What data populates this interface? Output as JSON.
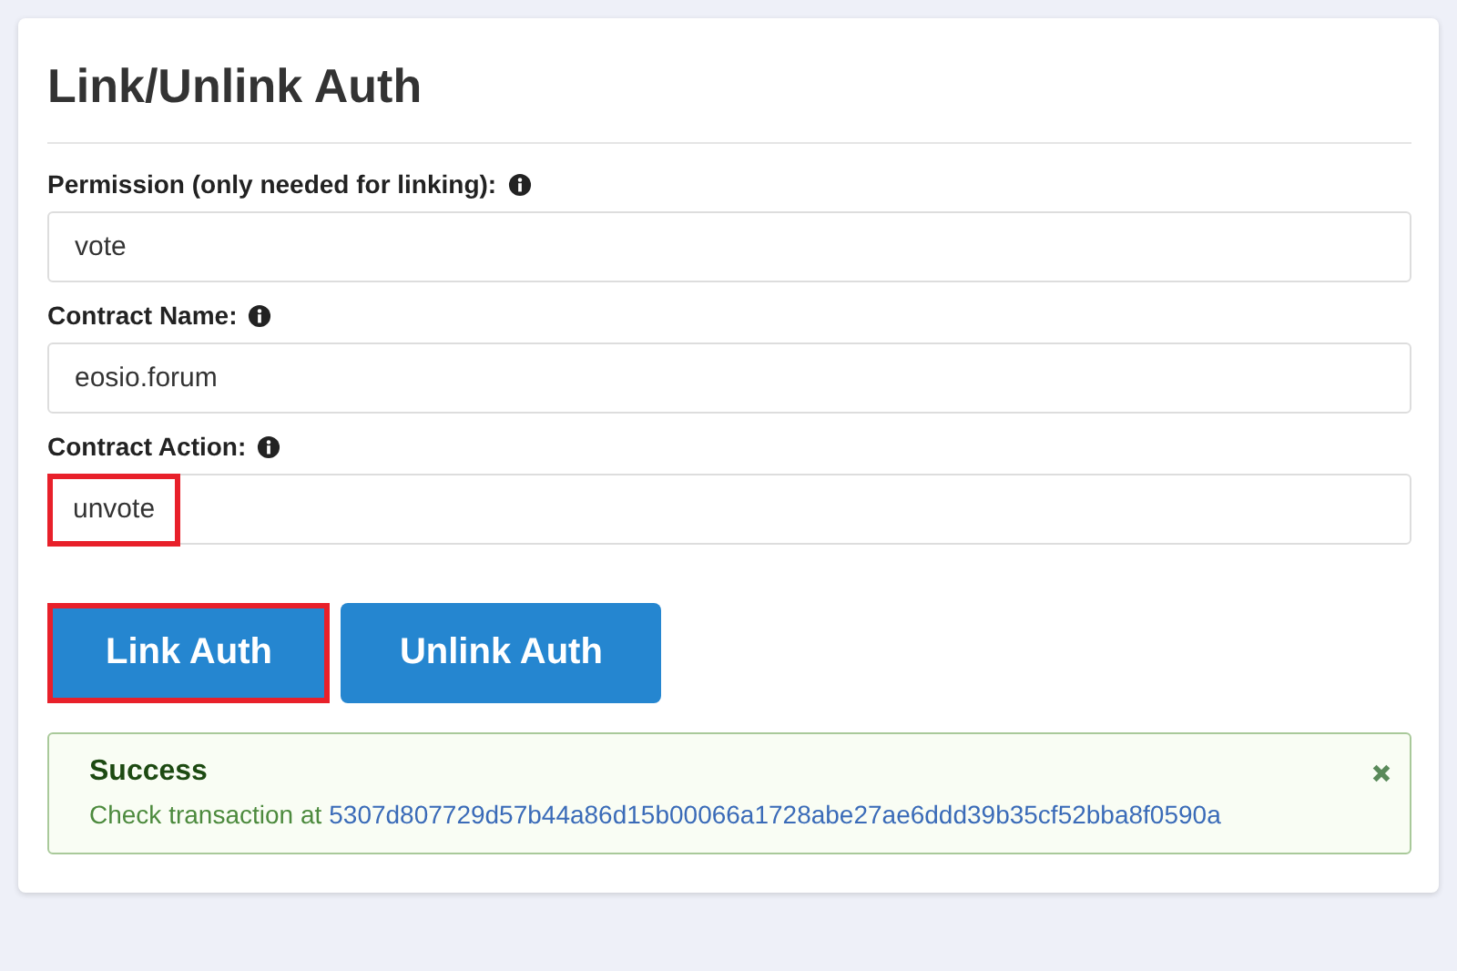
{
  "title": "Link/Unlink Auth",
  "fields": [
    {
      "label": "Permission (only needed for linking):",
      "value": "vote",
      "highlighted": false
    },
    {
      "label": "Contract Name:",
      "value": "eosio.forum",
      "highlighted": false
    },
    {
      "label": "Contract Action:",
      "value": "unvote",
      "highlighted": true
    }
  ],
  "buttons": [
    {
      "label": "Link Auth",
      "highlighted": true
    },
    {
      "label": "Unlink Auth",
      "highlighted": false
    }
  ],
  "alert": {
    "title": "Success",
    "text": "Check transaction at",
    "link": "5307d807729d57b44a86d15b00066a1728abe27ae6ddd39b35cf52bba8f0590a"
  }
}
